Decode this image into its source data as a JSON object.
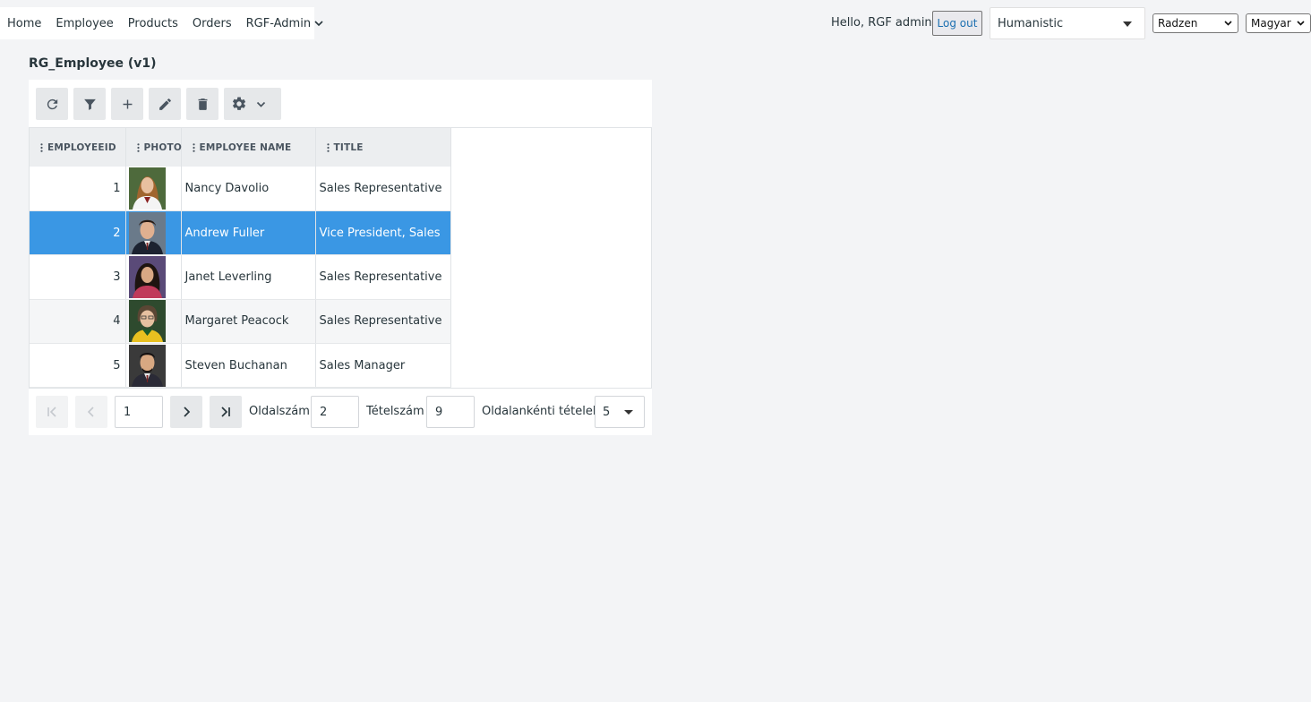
{
  "nav": {
    "items": [
      "Home",
      "Employee",
      "Products",
      "Orders",
      "RGF-Admin"
    ]
  },
  "header": {
    "greeting": "Hello, RGF admin!",
    "logout_label": "Log out",
    "theme_value": "Humanistic",
    "skin_value": "Radzen",
    "language_value": "Magyar"
  },
  "page": {
    "title": "RG_Employee (v1)"
  },
  "toolbar": {
    "icons": [
      "refresh-icon",
      "filter-icon",
      "add-icon",
      "edit-icon",
      "delete-icon",
      "gear-icon"
    ]
  },
  "grid": {
    "columns": [
      "EMPLOYEEID",
      "PHOTO",
      "EMPLOYEE NAME",
      "TITLE"
    ],
    "rows": [
      {
        "id": "1",
        "name": "Nancy Davolio",
        "title": "Sales Representative"
      },
      {
        "id": "2",
        "name": "Andrew Fuller",
        "title": "Vice President, Sales"
      },
      {
        "id": "3",
        "name": "Janet Leverling",
        "title": "Sales Representative"
      },
      {
        "id": "4",
        "name": "Margaret Peacock",
        "title": "Sales Representative"
      },
      {
        "id": "5",
        "name": "Steven Buchanan",
        "title": "Sales Manager"
      }
    ],
    "selected_row_index": 1
  },
  "pager": {
    "current_page": "1",
    "page_count_label": "Oldalszám",
    "page_count": "2",
    "item_count_label": "Tételszám",
    "item_count": "9",
    "page_size_label": "Oldalankénti tételek",
    "page_size": "5"
  },
  "colors": {
    "selected_row": "#3a97e4",
    "link": "#1b6fb0",
    "background": "#f3f4f6"
  }
}
